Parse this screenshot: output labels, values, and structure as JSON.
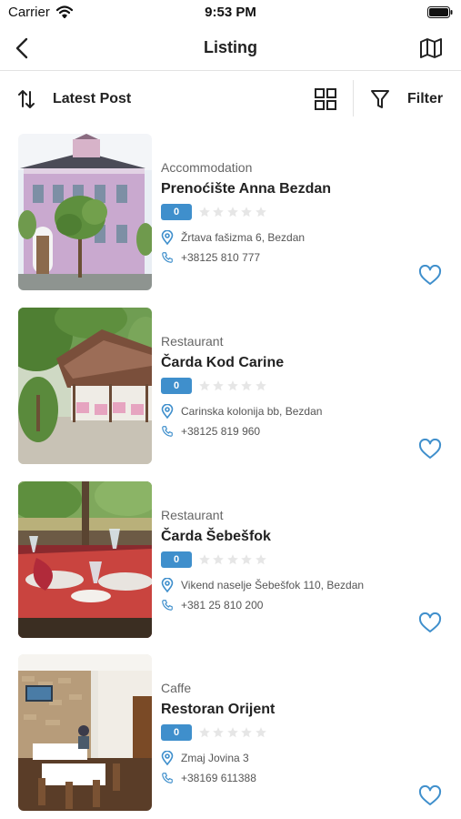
{
  "status_bar": {
    "carrier": "Carrier",
    "time": "9:53 PM"
  },
  "nav": {
    "title": "Listing",
    "back_icon": "chevron-left-icon",
    "map_icon": "map-icon"
  },
  "toolbar": {
    "sort_label": "Latest Post",
    "filter_label": "Filter"
  },
  "colors": {
    "accent": "#3f8fcc",
    "star_empty": "#e6e6e6",
    "text_primary": "#222222",
    "text_secondary": "#666666"
  },
  "listings": [
    {
      "category": "Accommodation",
      "title": "Prenoćište Anna Bezdan",
      "rating": "0",
      "stars": 0,
      "address": "Žrtava fašizma 6, Bezdan",
      "phone": "+38125 810 777"
    },
    {
      "category": "Restaurant",
      "title": "Čarda Kod Carine",
      "rating": "0",
      "stars": 0,
      "address": "Carinska kolonija bb, Bezdan",
      "phone": "+38125 819 960"
    },
    {
      "category": "Restaurant",
      "title": "Čarda Šebešfok",
      "rating": "0",
      "stars": 0,
      "address": "Vikend naselje Šebešfok 110, Bezdan",
      "phone": "+381 25 810 200"
    },
    {
      "category": "Caffe",
      "title": "Restoran Orijent",
      "rating": "0",
      "stars": 0,
      "address": "Zmaj Jovina 3",
      "phone": "+38169 611388"
    }
  ]
}
